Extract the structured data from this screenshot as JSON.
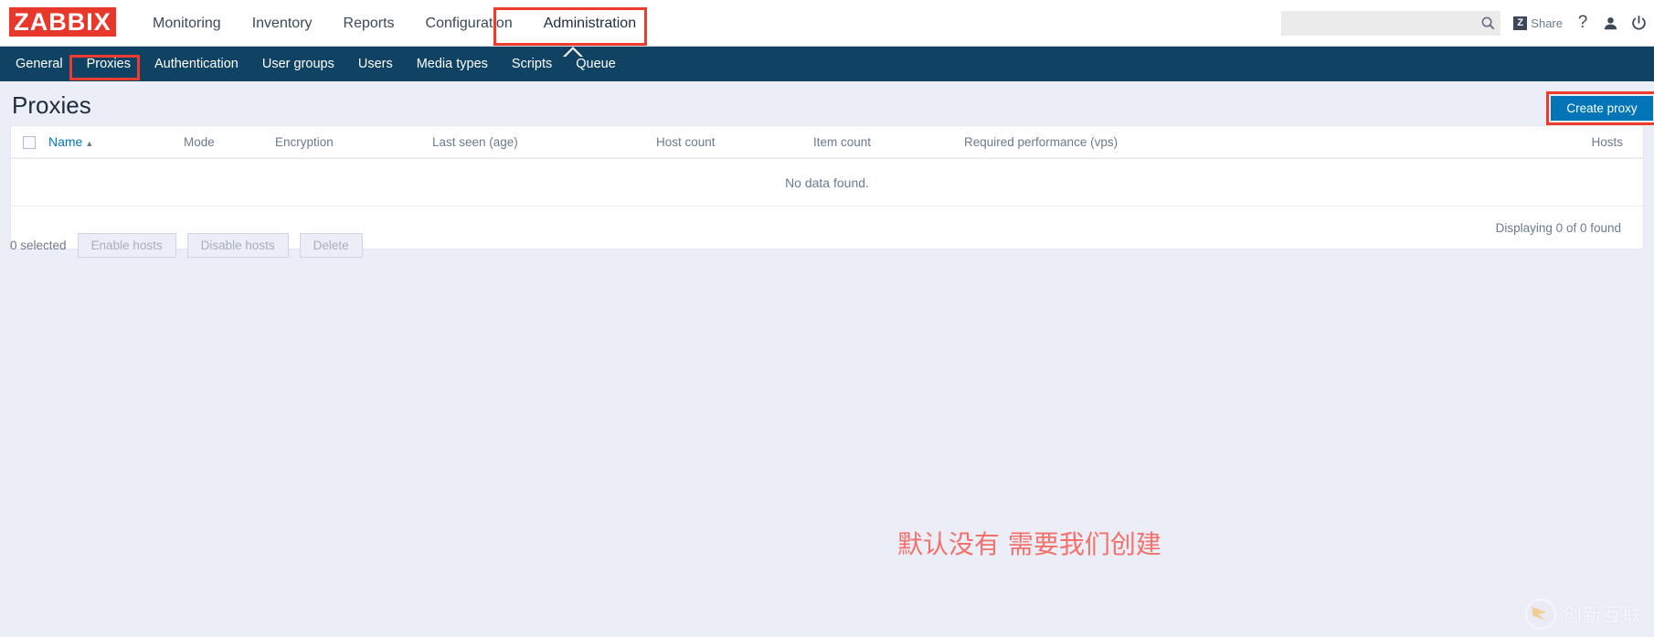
{
  "header": {
    "logo_text": "ZABBIX",
    "logo_color": "#e8372b",
    "nav": [
      {
        "label": "Monitoring"
      },
      {
        "label": "Inventory"
      },
      {
        "label": "Reports"
      },
      {
        "label": "Configuration"
      },
      {
        "label": "Administration"
      }
    ],
    "search": {
      "value": "",
      "placeholder": ""
    },
    "share_badge": "Z",
    "share_label": "Share",
    "help_label": "?"
  },
  "subnav": {
    "items": [
      {
        "label": "General"
      },
      {
        "label": "Proxies"
      },
      {
        "label": "Authentication"
      },
      {
        "label": "User groups"
      },
      {
        "label": "Users"
      },
      {
        "label": "Media types"
      },
      {
        "label": "Scripts"
      },
      {
        "label": "Queue"
      }
    ],
    "active": "Proxies",
    "background": "#0f4263"
  },
  "page": {
    "title": "Proxies",
    "create_button": "Create proxy",
    "create_button_color": "#0275b8"
  },
  "table": {
    "columns": [
      {
        "label": "Name",
        "sort": "▲"
      },
      {
        "label": "Mode"
      },
      {
        "label": "Encryption"
      },
      {
        "label": "Last seen (age)"
      },
      {
        "label": "Host count"
      },
      {
        "label": "Item count"
      },
      {
        "label": "Required performance (vps)"
      },
      {
        "label": "Hosts"
      }
    ],
    "rows": [],
    "empty_message": "No data found.",
    "footer": "Displaying 0 of 0 found"
  },
  "actions": {
    "selected_text": "0 selected",
    "buttons": [
      {
        "label": "Enable hosts",
        "disabled": true
      },
      {
        "label": "Disable hosts",
        "disabled": true
      },
      {
        "label": "Delete",
        "disabled": true
      }
    ]
  },
  "annotations": {
    "note_text": "默认没有 需要我们创建",
    "note_color": "#f4706b",
    "highlight_color": "#ef3b2d"
  },
  "watermark": {
    "text": "创新互联"
  }
}
